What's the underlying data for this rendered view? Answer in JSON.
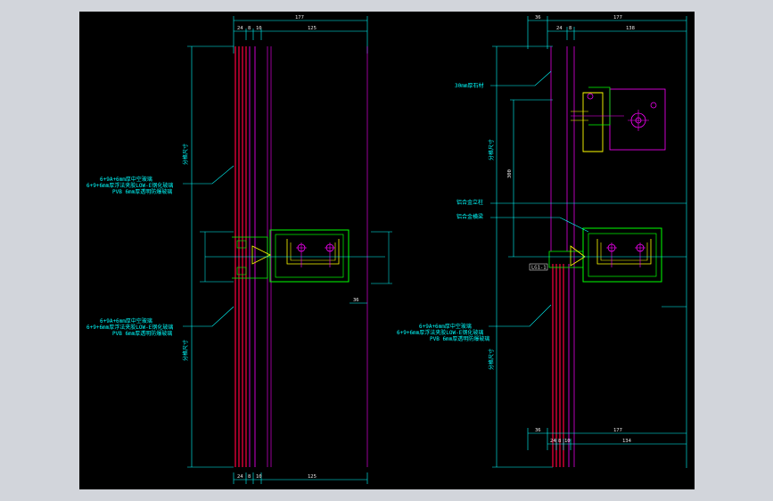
{
  "colors": {
    "background": "#000000",
    "window": "#d2d5db",
    "glass": "#ff0040",
    "mullion": "#ff00ff",
    "frame": "#00ff00",
    "bracket": "#ffff00",
    "dimension": "#00ffff",
    "text": "#ffffff"
  },
  "left_view": {
    "top_dims": [
      "177",
      "24",
      "8",
      "10",
      "125"
    ],
    "bottom_dims": [
      "24",
      "8",
      "10",
      "125"
    ],
    "side_dim": "分格尺寸",
    "side_dim_lower": "分格尺寸",
    "right_dim_small": "36",
    "label_upper": [
      "6+9A+6mm厚中空玻璃",
      "6+9+6mm厚浮法夹胶LOW-E钢化玻璃",
      "PVB 6mm厚透明防爆玻璃"
    ],
    "label_lower": [
      "6+9A+6mm厚中空玻璃",
      "6+9+6mm厚浮法夹胶LOW-E钢化玻璃",
      "PVB 6mm厚透明防爆玻璃"
    ]
  },
  "right_view": {
    "top_dims": [
      "36",
      "177",
      "24",
      "8",
      "138"
    ],
    "bottom_dims": [
      "36",
      "177",
      "24",
      "8",
      "10",
      "134"
    ],
    "side_dim": "分格尺寸",
    "side_dim_lower": "分格尺寸",
    "small_dim": "300",
    "label_bracket": "30mm厚石材",
    "label_post": "铝合金立柱",
    "label_sill": "铝合金横梁",
    "label_glass": [
      "6+9A+6mm厚中空玻璃",
      "6+9+6mm厚浮法夹胶LOW-E钢化玻璃",
      "PVB 6mm厚透明防爆玻璃"
    ],
    "box_text": "LG1-1"
  }
}
